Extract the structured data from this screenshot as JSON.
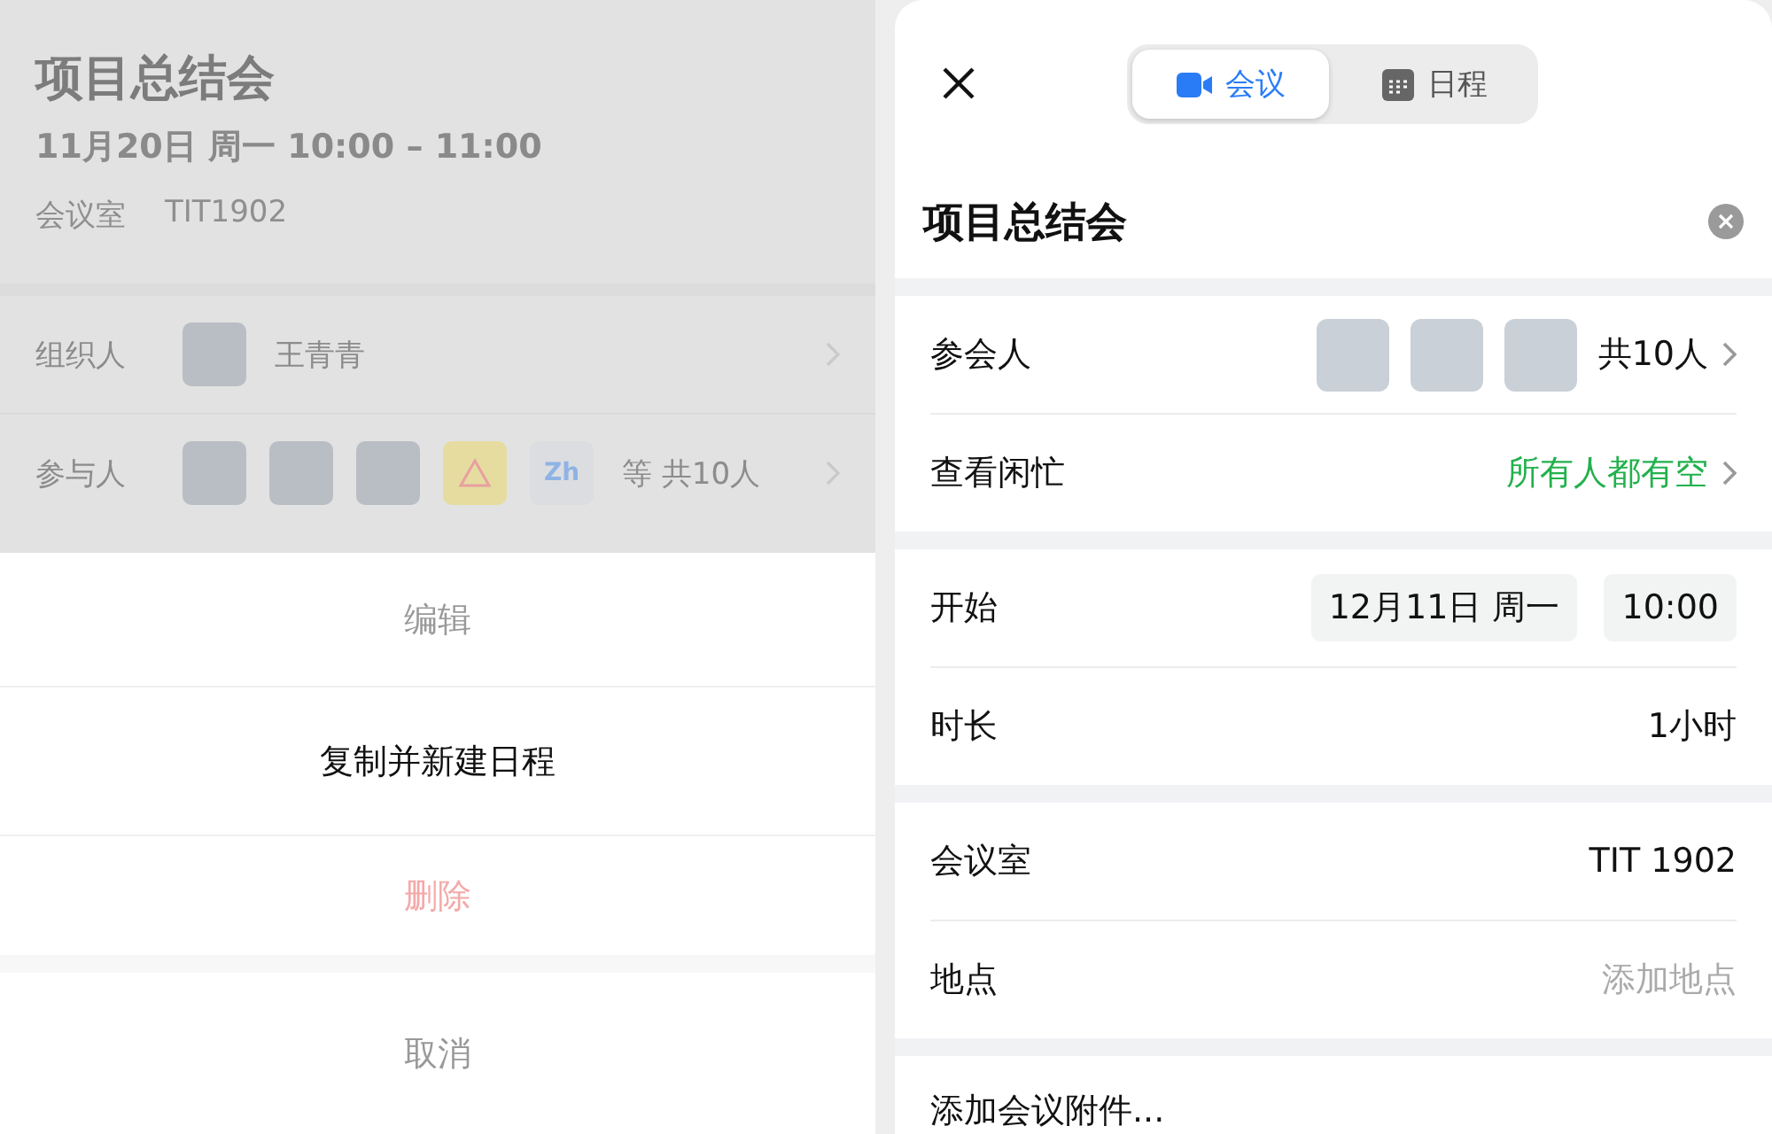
{
  "detail": {
    "title": "项目总结会",
    "time": "11月20日 周一 10:00 – 11:00",
    "room_label": "会议室",
    "room": "TIT1902",
    "organizer": {
      "label": "组织人",
      "name": "王青青"
    },
    "participants": {
      "label": "参与人",
      "avatars": [
        {
          "kind": "photo"
        },
        {
          "kind": "photo"
        },
        {
          "kind": "photo"
        },
        {
          "kind": "icon"
        },
        {
          "kind": "initials",
          "text": "Zh"
        }
      ],
      "total": "等 共10人"
    }
  },
  "action_sheet": {
    "items": [
      {
        "label": "编辑",
        "kind": "normal",
        "disabled": true
      },
      {
        "label": "复制并新建日程",
        "kind": "normal",
        "disabled": false
      },
      {
        "label": "删除",
        "kind": "destructive",
        "disabled": true
      }
    ],
    "cancel": "取消"
  },
  "editor": {
    "tabs": [
      {
        "label": "会议",
        "selected": true
      },
      {
        "label": "日程",
        "selected": false
      }
    ],
    "title": "项目总结会",
    "sections": [
      [
        {
          "kind": "people",
          "label": "参会人",
          "avatars": [
            {
              "kind": "photo"
            },
            {
              "kind": "photo"
            },
            {
              "kind": "photo"
            }
          ],
          "value": "共10人"
        },
        {
          "kind": "status",
          "label": "查看闲忙",
          "value": "所有人都有空"
        }
      ],
      [
        {
          "kind": "datetime",
          "label": "开始",
          "date": "12月11日 周一",
          "time": "10:00"
        },
        {
          "kind": "value",
          "label": "时长",
          "value": "1小时"
        }
      ],
      [
        {
          "kind": "value",
          "label": "会议室",
          "value": "TIT 1902"
        },
        {
          "kind": "placeholder",
          "label": "地点",
          "placeholder": "添加地点"
        }
      ],
      [
        {
          "kind": "action",
          "label": "添加会议附件..."
        }
      ]
    ]
  }
}
